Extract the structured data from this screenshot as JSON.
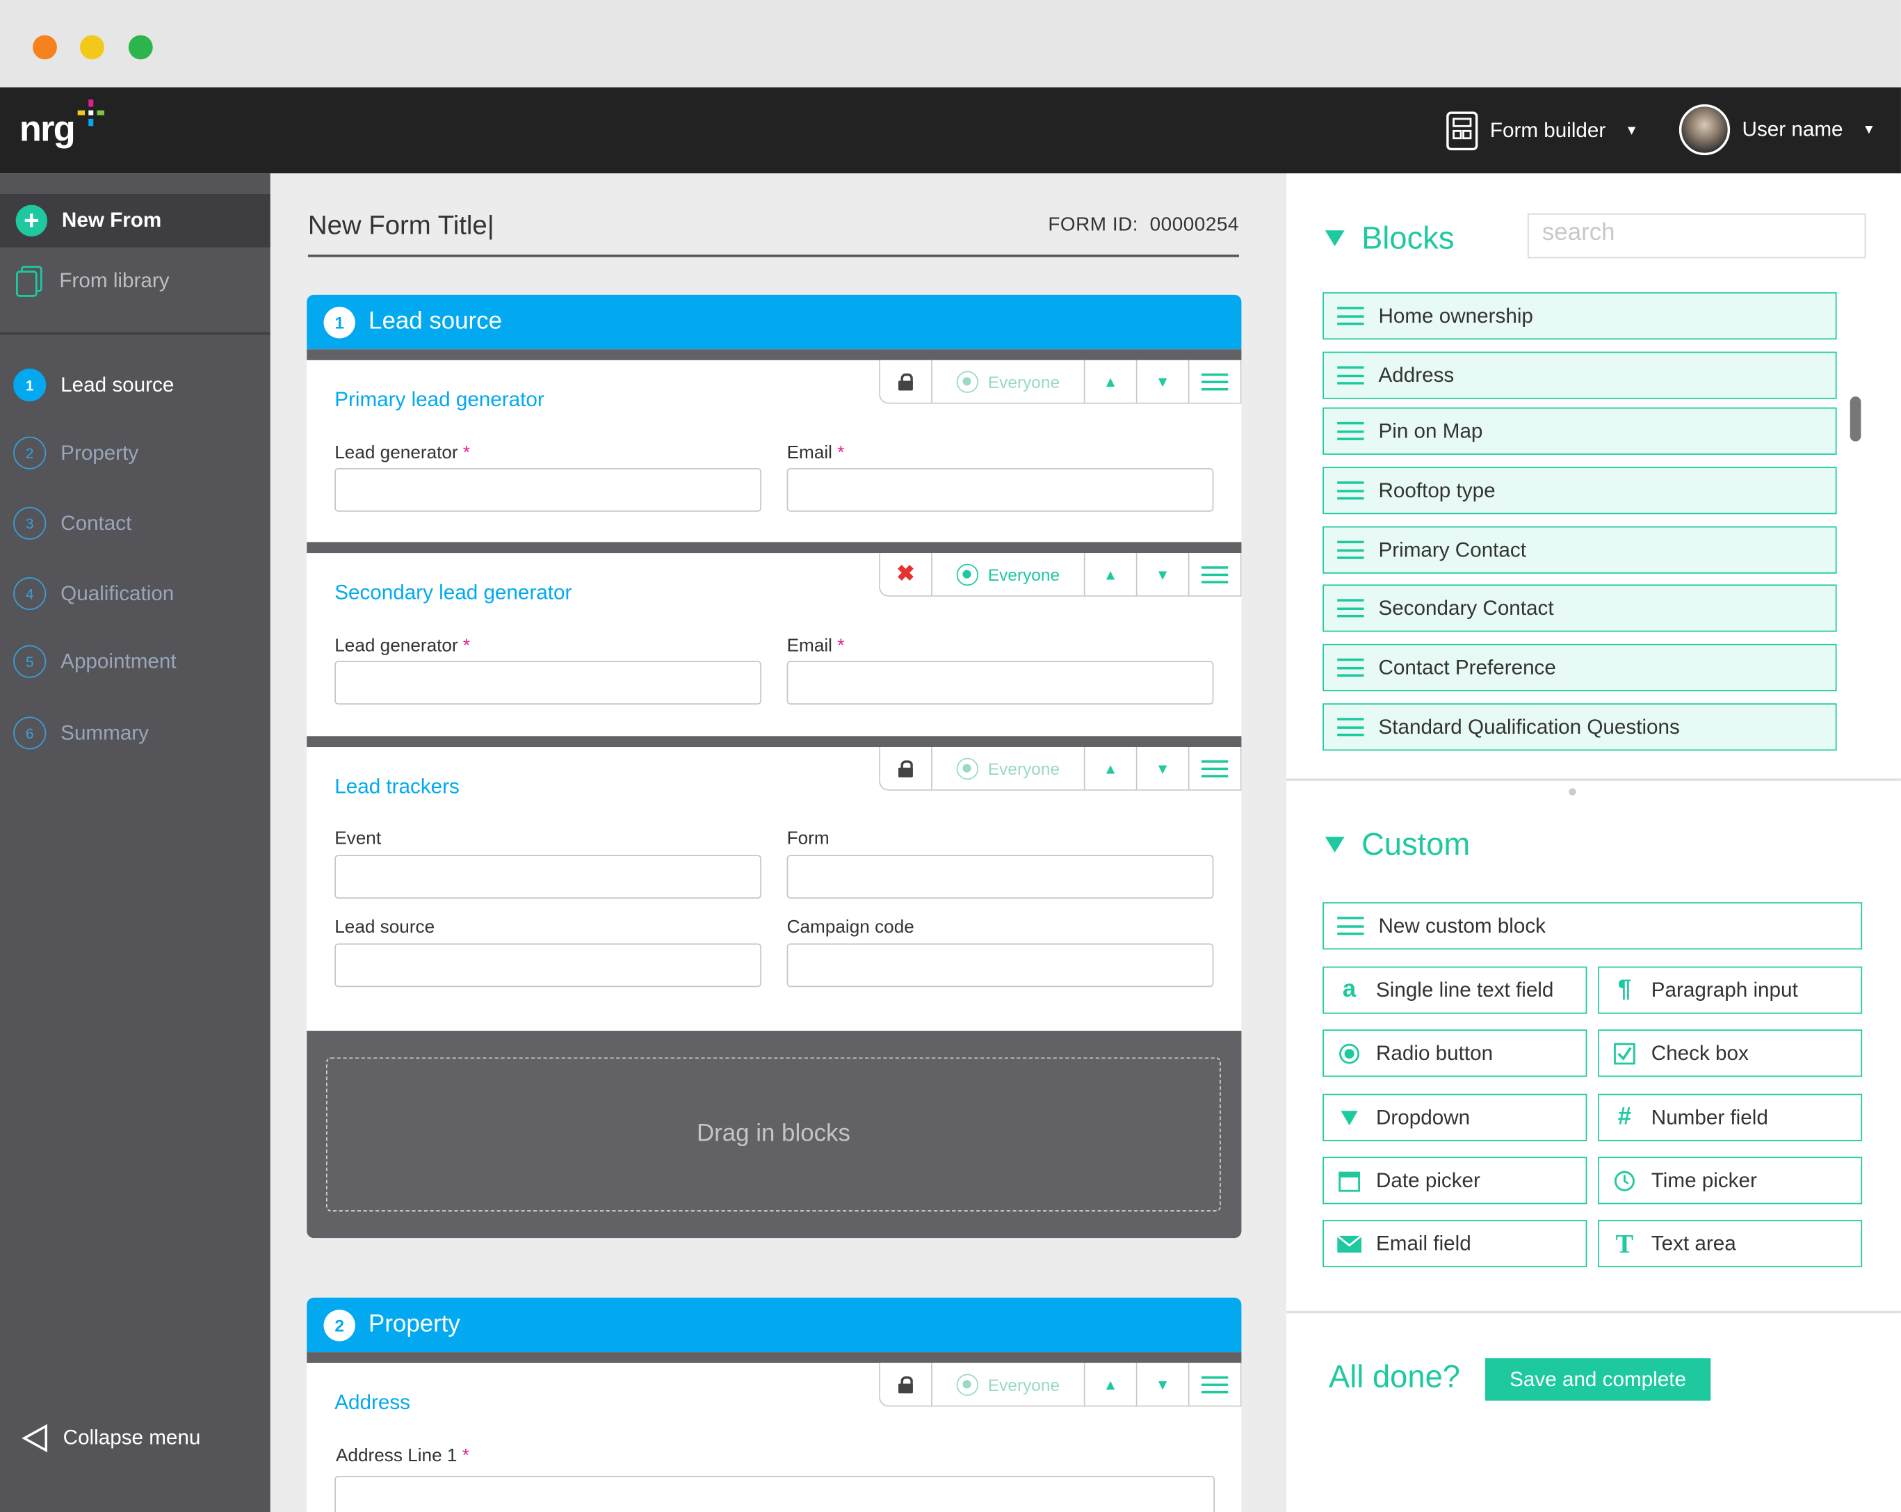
{
  "app": {
    "logo": "nrg"
  },
  "header": {
    "form_builder": "Form builder",
    "user_name": "User name"
  },
  "sidebar": {
    "new_from": "New From",
    "from_library": "From library",
    "steps": [
      {
        "num": "1",
        "label": "Lead source"
      },
      {
        "num": "2",
        "label": "Property"
      },
      {
        "num": "3",
        "label": "Contact"
      },
      {
        "num": "4",
        "label": "Qualification"
      },
      {
        "num": "5",
        "label": "Appointment"
      },
      {
        "num": "6",
        "label": "Summary"
      }
    ],
    "collapse": "Collapse menu"
  },
  "form": {
    "title": "New Form Title",
    "id_label": "FORM ID:",
    "id_value": "00000254",
    "sections": [
      {
        "num": "1",
        "title": "Lead source"
      },
      {
        "num": "2",
        "title": "Property"
      }
    ],
    "blocks": [
      {
        "title": "Primary lead generator",
        "visibility": "Everyone",
        "fields": [
          "Lead generator",
          "Email"
        ]
      },
      {
        "title": "Secondary lead generator",
        "visibility": "Everyone",
        "fields": [
          "Lead generator",
          "Email"
        ]
      },
      {
        "title": "Lead trackers",
        "visibility": "Everyone",
        "fields": [
          "Event",
          "Form",
          "Lead source",
          "Campaign code"
        ]
      },
      {
        "title": "Address",
        "visibility": "Everyone",
        "fields": [
          "Address Line 1"
        ]
      }
    ],
    "required_mark": "*",
    "drop_zone": "Drag in blocks"
  },
  "blocks_panel": {
    "title": "Blocks",
    "search_placeholder": "search",
    "items": [
      "Home ownership",
      "Address",
      "Pin on Map",
      "Rooftop type",
      "Primary Contact",
      "Secondary Contact",
      "Contact Preference",
      "Standard Qualification Questions"
    ]
  },
  "custom_panel": {
    "title": "Custom",
    "new_block": "New custom block",
    "items": [
      "Single line text field",
      "Paragraph input",
      "Radio button",
      "Check box",
      "Dropdown",
      "Number field",
      "Date picker",
      "Time picker",
      "Email field",
      "Text area"
    ]
  },
  "footer": {
    "all_done": "All done?",
    "save": "Save and complete"
  },
  "colors": {
    "primary_blue": "#03a9f0",
    "accent_green": "#1ec9a0",
    "required_pink": "#e0208a"
  }
}
